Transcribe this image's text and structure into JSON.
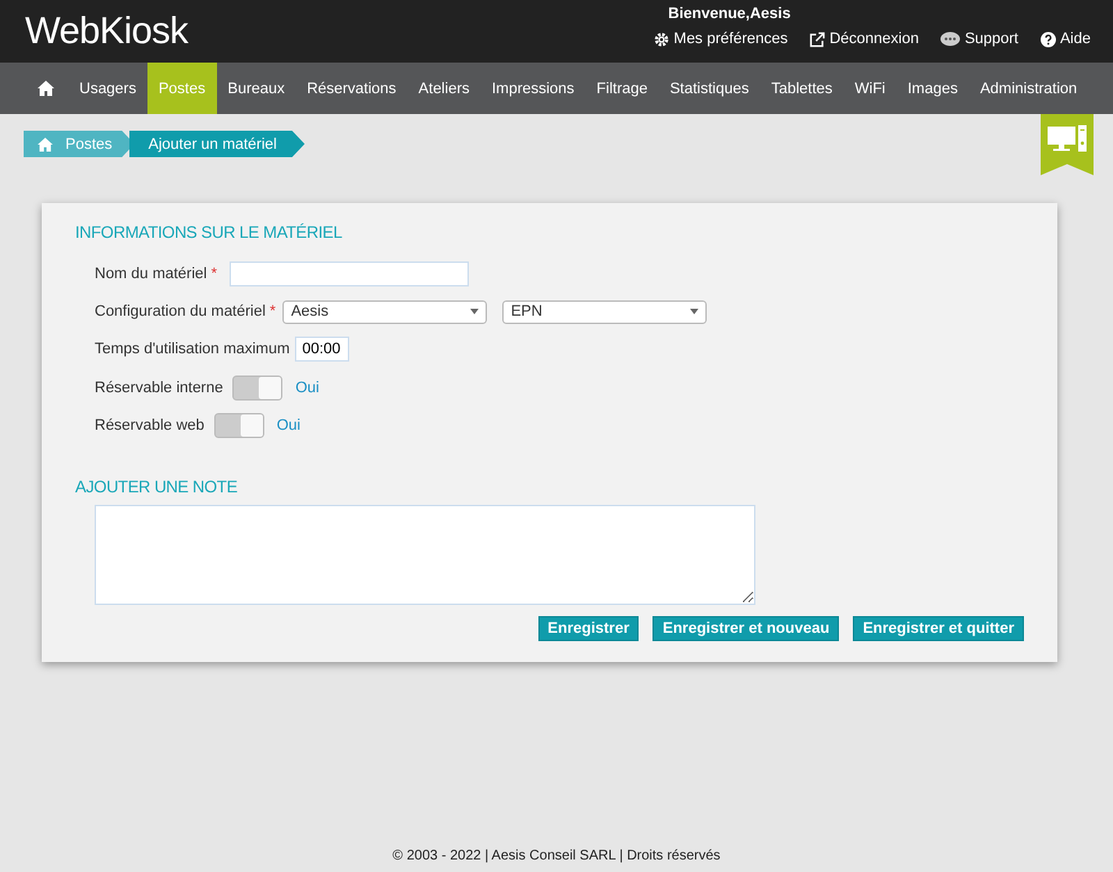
{
  "header": {
    "logo": "WebKiosk",
    "welcome": "Bienvenue,Aesis",
    "links": [
      {
        "kind": "gear",
        "label": "Mes préférences"
      },
      {
        "kind": "external",
        "label": "Déconnexion"
      },
      {
        "kind": "chat",
        "label": "Support"
      },
      {
        "kind": "help",
        "label": "Aide"
      }
    ]
  },
  "nav": [
    {
      "kind": "home",
      "selected": false
    },
    {
      "label": "Usagers",
      "selected": false
    },
    {
      "label": "Postes",
      "selected": true
    },
    {
      "label": "Bureaux",
      "selected": false
    },
    {
      "label": "Réservations",
      "selected": false
    },
    {
      "label": "Ateliers",
      "selected": false
    },
    {
      "label": "Impressions",
      "selected": false
    },
    {
      "label": "Filtrage",
      "selected": false
    },
    {
      "label": "Statistiques",
      "selected": false
    },
    {
      "label": "Tablettes",
      "selected": false
    },
    {
      "label": "WiFi",
      "selected": false
    },
    {
      "label": "Images",
      "selected": false
    },
    {
      "label": "Administration",
      "selected": false
    }
  ],
  "breadcrumb": [
    "Postes",
    "Ajouter un matériel"
  ],
  "form": {
    "title": "INFORMATIONS SUR LE MATÉRIEL",
    "fields": [
      {
        "kind": "text",
        "label": "Nom du matériel",
        "required_mark": "*"
      },
      {
        "kind": "selects",
        "label": "Configuration du matériel",
        "required_mark": "*",
        "values": [
          "Aesis",
          "EPN"
        ]
      },
      {
        "kind": "time",
        "label": "Temps d'utilisation maximum",
        "value": "00:00"
      },
      {
        "kind": "toggle",
        "label": "Réservable interne",
        "on": true,
        "state_label": "Oui"
      },
      {
        "kind": "toggle",
        "label": "Réservable web",
        "on": true,
        "state_label": "Oui"
      }
    ],
    "note_title": "AJOUTER UNE NOTE",
    "buttons": [
      "Enregistrer",
      "Enregistrer et nouveau",
      "Enregistrer et quitter"
    ]
  },
  "footer": "© 2003 - 2022 | Aesis Conseil SARL | Droits réservés"
}
